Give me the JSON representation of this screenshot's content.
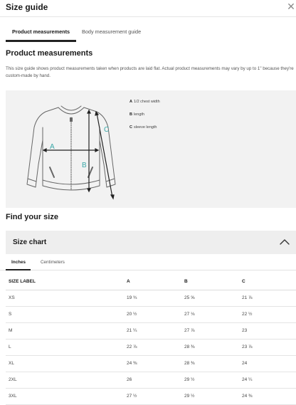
{
  "modal": {
    "title": "Size guide",
    "close_glyph": "✕"
  },
  "tabs": [
    {
      "label": "Product measurements",
      "active": true
    },
    {
      "label": "Body measurement guide",
      "active": false
    }
  ],
  "product": {
    "heading": "Product measurements",
    "description": "This size guide shows product measurements taken when products are laid flat. Actual product measurements may vary by up to 1\" because they're custom-made by hand.",
    "diagram_letters": {
      "a": "A",
      "b": "B",
      "c": "C"
    },
    "legend": [
      {
        "key": "A",
        "text": "1/2 chest width"
      },
      {
        "key": "B",
        "text": "length"
      },
      {
        "key": "C",
        "text": "sleeve length"
      }
    ]
  },
  "find": {
    "heading": "Find your size"
  },
  "size_chart": {
    "title": "Size chart",
    "expanded": true,
    "unit_tabs": [
      {
        "label": "Inches",
        "active": true
      },
      {
        "label": "Centimeters",
        "active": false
      }
    ],
    "headers": [
      "SIZE LABEL",
      "A",
      "B",
      "C"
    ],
    "rows": [
      [
        "XS",
        "19 ¾",
        "25 ⅝",
        "21 ⅞"
      ],
      [
        "S",
        "20 ½",
        "27 ⅛",
        "22 ½"
      ],
      [
        "M",
        "21 ¼",
        "27 ⅞",
        "23"
      ],
      [
        "L",
        "22 ⅞",
        "28 ⅜",
        "23 ⅞"
      ],
      [
        "XL",
        "24 ⅜",
        "28 ⅜",
        "24"
      ],
      [
        "2XL",
        "26",
        "29 ½",
        "24 ¼"
      ],
      [
        "3XL",
        "27 ½",
        "29 ½",
        "24 ⅜"
      ]
    ]
  },
  "colors": {
    "accent_teal": "#3aa8a8",
    "dark": "#1a1a1a",
    "panel_gray": "#f2f2f2"
  }
}
